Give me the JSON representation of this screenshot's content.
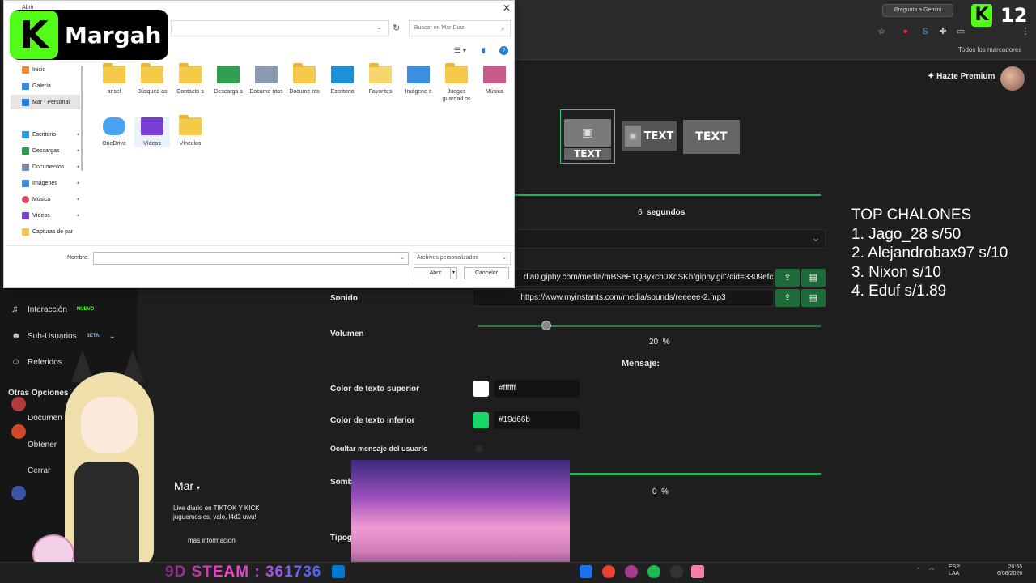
{
  "stream_overlay": {
    "brand_name": "Margah",
    "k_letter": "K",
    "viewer_count": "12",
    "steam_banner": "9D STEAM : 361736",
    "top_list": [
      "TOP CHALONES",
      "1. Jago_28 s/50",
      "2. Alejandrobax97 s/10",
      "3. Nixon s/10",
      "4. Eduf s/1.89"
    ]
  },
  "browser": {
    "gemini_pill": "Pregunta a Gemini",
    "bookmarks_all": "Todos los marcadores"
  },
  "page": {
    "premium_label": "Hazte Premium",
    "style_text": "TEXT",
    "duration_value": "6",
    "duration_unit": "segundos",
    "gif_url": "dia0.giphy.com/media/mBSeE1Q3yxcb0XoSKh/giphy.gif?cid=3309efc1",
    "sound_label": "Sonido",
    "sound_url": "https://www.myinstants.com/media/sounds/reeeee-2.mp3",
    "volume_label": "Volumen",
    "volume_value": "20",
    "volume_fraction": 0.2,
    "pct_sign": "%",
    "message_label": "Mensaje:",
    "top_color_label": "Color de texto superior",
    "top_color_value": "#ffffff",
    "bottom_color_label": "Color de texto inferior",
    "bottom_color_value": "#19d66b",
    "hide_user_label": "Ocultar mensaje del usuario",
    "shadow_label": "Somb",
    "shadow_value": "0",
    "type_label": "Tipog",
    "colors": {
      "accent": "#27ae60",
      "bottom_swatch": "#19d66b",
      "top_swatch": "#ffffff"
    }
  },
  "side_menu": {
    "items": [
      {
        "label": "Interacción",
        "badge": "NUEVO",
        "badge_color": "#53fc18"
      },
      {
        "label": "Sub-Usuarios",
        "badge": "BETA",
        "badge_color": "#8ab4f8"
      },
      {
        "label": "Referidos"
      },
      {
        "label": "Otras Opciones"
      },
      {
        "label": "Documen"
      },
      {
        "label": "Obtener"
      },
      {
        "label": "Cerrar"
      }
    ]
  },
  "profile": {
    "name": "Mar",
    "bio": "Live diario en TIKTOK Y KICK\njuguemos cs, valo, l4d2 uwu!",
    "more": "más información"
  },
  "dialog": {
    "title": "Abrir",
    "search_placeholder": "Buscar en Mar Diaz",
    "nav_items": [
      "Inicio",
      "Galería",
      "Mar - Personal",
      "Escritorio",
      "Descargas",
      "Documentos",
      "Imágenes",
      "Música",
      "Vídeos",
      "Capturas de par"
    ],
    "files": [
      {
        "label": "ansel",
        "icon": "folder-icon"
      },
      {
        "label": "Búsqued as",
        "icon": "search-folder-icon"
      },
      {
        "label": "Contacto s",
        "icon": "contacts-folder-icon"
      },
      {
        "label": "Descarga s",
        "icon": "downloads-folder-icon"
      },
      {
        "label": "Docume ntos",
        "icon": "documents-folder-icon"
      },
      {
        "label": "Docume nts",
        "icon": "folder-icon"
      },
      {
        "label": "Escritorio",
        "icon": "desktop-folder-icon"
      },
      {
        "label": "Favorites",
        "icon": "folder-icon"
      },
      {
        "label": "Imágene s",
        "icon": "pictures-folder-icon"
      },
      {
        "label": "Juegos guardad os",
        "icon": "games-folder-icon"
      },
      {
        "label": "Música",
        "icon": "music-folder-icon"
      },
      {
        "label": "OneDrive",
        "icon": "onedrive-icon"
      },
      {
        "label": "Vídeos",
        "icon": "videos-folder-icon"
      },
      {
        "label": "Vínculos",
        "icon": "links-folder-icon"
      }
    ],
    "name_label": "Nombre:",
    "filter_value": "Archivos personalizados",
    "open_button": "Abrir",
    "cancel_button": "Cancelar"
  },
  "taskbar": {
    "lang_line1": "ESP",
    "lang_line2": "LAA",
    "time": "20:55",
    "date": "6/08/2026"
  }
}
